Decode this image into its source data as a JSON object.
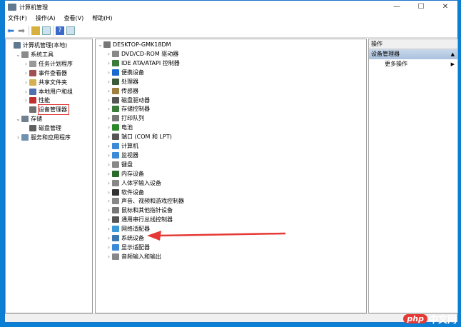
{
  "window": {
    "title": "计算机管理",
    "minimize": "—",
    "maximize": "☐",
    "close": "✕"
  },
  "menu": [
    "文件(F)",
    "操作(A)",
    "查看(V)",
    "帮助(H)"
  ],
  "left_tree": [
    {
      "label": "计算机管理(本地)",
      "indent": 0,
      "chev": "",
      "color": "#607890"
    },
    {
      "label": "系统工具",
      "indent": 1,
      "chev": "⌄",
      "color": "#8a8a8a"
    },
    {
      "label": "任务计划程序",
      "indent": 2,
      "chev": "›",
      "color": "#999"
    },
    {
      "label": "事件查看器",
      "indent": 2,
      "chev": "›",
      "color": "#a05050"
    },
    {
      "label": "共享文件夹",
      "indent": 2,
      "chev": "›",
      "color": "#d4b050"
    },
    {
      "label": "本地用户和组",
      "indent": 2,
      "chev": "›",
      "color": "#5070b0"
    },
    {
      "label": "性能",
      "indent": 2,
      "chev": "›",
      "color": "#c03030"
    },
    {
      "label": "设备管理器",
      "indent": 2,
      "chev": "",
      "color": "#707070",
      "highlight": true
    },
    {
      "label": "存储",
      "indent": 1,
      "chev": "⌄",
      "color": "#708090"
    },
    {
      "label": "磁盘管理",
      "indent": 2,
      "chev": "",
      "color": "#606060"
    },
    {
      "label": "服务和应用程序",
      "indent": 1,
      "chev": "›",
      "color": "#7090b0"
    }
  ],
  "device_root": "DESKTOP-GMK18DM",
  "devices": [
    "DVD/CD-ROM 驱动器",
    "IDE ATA/ATAPI 控制器",
    "便携设备",
    "处理器",
    "传感器",
    "磁盘驱动器",
    "存储控制器",
    "打印队列",
    "电池",
    "端口 (COM 和 LPT)",
    "计算机",
    "监视器",
    "键盘",
    "内存设备",
    "人体学输入设备",
    "软件设备",
    "声音、视频和游戏控制器",
    "鼠标和其他指针设备",
    "通用串行总线控制器",
    "网络适配器",
    "系统设备",
    "显示适配器",
    "音频输入和输出"
  ],
  "device_colors": [
    "#888",
    "#3a7a3a",
    "#1a6ad0",
    "#3a5a3a",
    "#a08040",
    "#555",
    "#3a7a3a",
    "#777",
    "#2a8a2a",
    "#555",
    "#3a8ad8",
    "#3a8ad8",
    "#888",
    "#2a6a2a",
    "#888",
    "#333",
    "#888",
    "#777",
    "#555",
    "#3a9ad8",
    "#3a7ab0",
    "#3a8ad8",
    "#888"
  ],
  "actions": {
    "header": "操作",
    "section": "设备管理器",
    "section_arrow": "▲",
    "more": "更多操作",
    "more_arrow": "▶"
  },
  "annotation": {
    "target": "系统设备",
    "color": "#e53935"
  },
  "watermark": {
    "php": "php",
    "cn": "中文网"
  }
}
